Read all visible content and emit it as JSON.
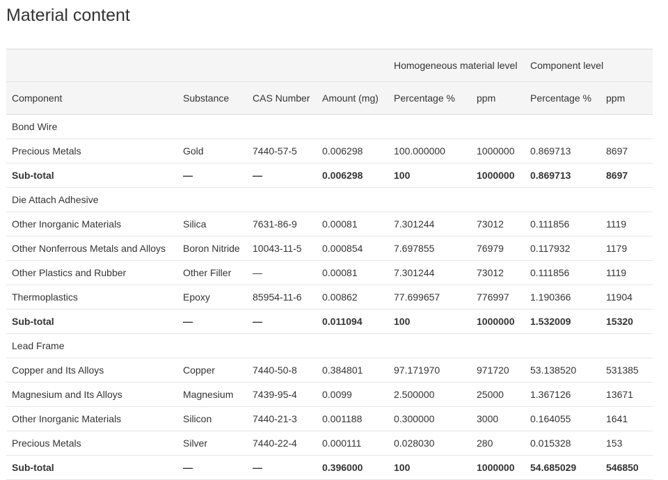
{
  "page_title": "Material content",
  "group_headers": {
    "homogeneous": "Homogeneous material level",
    "component_level": "Component level"
  },
  "columns": [
    "Component",
    "Substance",
    "CAS Number",
    "Amount (mg)",
    "Percentage %",
    "ppm",
    "Percentage %",
    "ppm"
  ],
  "rows": [
    {
      "type": "section",
      "cells": [
        "Bond Wire"
      ]
    },
    {
      "type": "data",
      "cells": [
        "Precious Metals",
        "Gold",
        "7440-57-5",
        "0.006298",
        "100.000000",
        "1000000",
        "0.869713",
        "8697"
      ]
    },
    {
      "type": "subtotal",
      "cells": [
        "Sub-total",
        "—",
        "—",
        "0.006298",
        "100",
        "1000000",
        "0.869713",
        "8697"
      ]
    },
    {
      "type": "section",
      "cells": [
        "Die Attach Adhesive"
      ]
    },
    {
      "type": "data",
      "cells": [
        "Other Inorganic Materials",
        "Silica",
        "7631-86-9",
        "0.00081",
        "7.301244",
        "73012",
        "0.111856",
        "1119"
      ]
    },
    {
      "type": "data",
      "cells": [
        "Other Nonferrous Metals and Alloys",
        "Boron Nitride",
        "10043-11-5",
        "0.000854",
        "7.697855",
        "76979",
        "0.117932",
        "1179"
      ]
    },
    {
      "type": "data",
      "cells": [
        "Other Plastics and Rubber",
        "Other Filler",
        "—",
        "0.00081",
        "7.301244",
        "73012",
        "0.111856",
        "1119"
      ]
    },
    {
      "type": "data",
      "cells": [
        "Thermoplastics",
        "Epoxy",
        "85954-11-6",
        "0.00862",
        "77.699657",
        "776997",
        "1.190366",
        "11904"
      ]
    },
    {
      "type": "subtotal",
      "cells": [
        "Sub-total",
        "—",
        "—",
        "0.011094",
        "100",
        "1000000",
        "1.532009",
        "15320"
      ]
    },
    {
      "type": "section",
      "cells": [
        "Lead Frame"
      ]
    },
    {
      "type": "data",
      "cells": [
        "Copper and Its Alloys",
        "Copper",
        "7440-50-8",
        "0.384801",
        "97.171970",
        "971720",
        "53.138520",
        "531385"
      ]
    },
    {
      "type": "data",
      "cells": [
        "Magnesium and Its Alloys",
        "Magnesium",
        "7439-95-4",
        "0.0099",
        "2.500000",
        "25000",
        "1.367126",
        "13671"
      ]
    },
    {
      "type": "data",
      "cells": [
        "Other Inorganic Materials",
        "Silicon",
        "7440-21-3",
        "0.001188",
        "0.300000",
        "3000",
        "0.164055",
        "1641"
      ]
    },
    {
      "type": "data",
      "cells": [
        "Precious Metals",
        "Silver",
        "7440-22-4",
        "0.000111",
        "0.028030",
        "280",
        "0.015328",
        "153"
      ]
    },
    {
      "type": "subtotal",
      "cells": [
        "Sub-total",
        "—",
        "—",
        "0.396000",
        "100",
        "1000000",
        "54.685029",
        "546850"
      ]
    }
  ]
}
